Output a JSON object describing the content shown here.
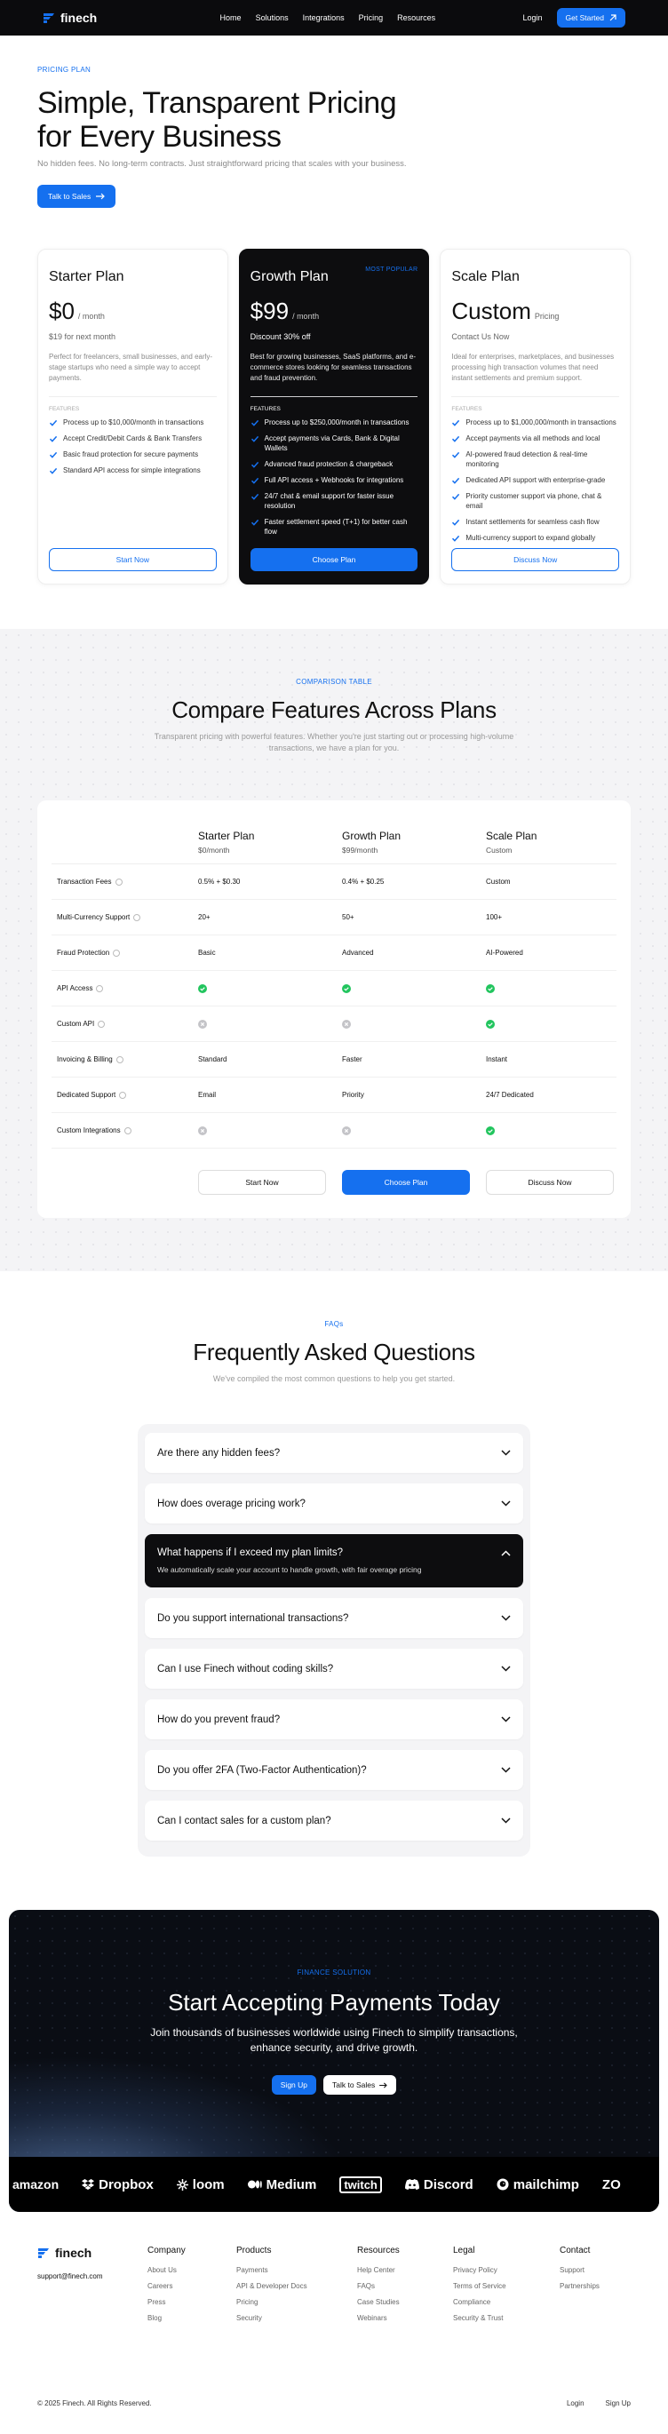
{
  "nav": {
    "brand": "finech",
    "links": [
      "Home",
      "Solutions",
      "Integrations",
      "Pricing",
      "Resources"
    ],
    "login": "Login",
    "cta": "Get Started"
  },
  "hero": {
    "eyebrow": "PRICING PLAN",
    "title": "Simple, Transparent Pricing for Every Business",
    "subtitle": "No hidden fees. No long-term contracts. Just straightforward pricing that scales with your business.",
    "cta": "Talk to Sales"
  },
  "plans": [
    {
      "name": "Starter Plan",
      "price": "$0",
      "period": "/ month",
      "sub": "$19 for next month",
      "desc": "Perfect for freelancers, small businesses, and early-stage startups who need a simple way to accept payments.",
      "features_label": "FEATURES",
      "features": [
        "Process up to $10,000/month in transactions",
        "Accept Credit/Debit Cards & Bank Transfers",
        "Basic fraud protection for secure payments",
        "Standard API access for simple integrations"
      ],
      "button": "Start Now"
    },
    {
      "name": "Growth Plan",
      "badge": "MOST POPULAR",
      "price": "$99",
      "period": "/ month",
      "sub": "Discount 30% off",
      "desc": "Best for growing businesses, SaaS platforms, and e-commerce stores looking for seamless transactions and fraud prevention.",
      "features_label": "FEATURES",
      "features": [
        "Process up to $250,000/month in transactions",
        "Accept payments via Cards, Bank & Digital Wallets",
        "Advanced fraud protection & chargeback",
        "Full API access + Webhooks for integrations",
        "24/7 chat & email support for faster issue resolution",
        "Faster settlement speed (T+1) for better cash flow"
      ],
      "button": "Choose Plan"
    },
    {
      "name": "Scale Plan",
      "price": "Custom",
      "period": "Pricing",
      "sub": "Contact Us Now",
      "desc": "Ideal for enterprises, marketplaces, and businesses processing high transaction volumes that need instant settlements and premium support.",
      "features_label": "FEATURES",
      "features": [
        "Process up to $1,000,000/month in transactions",
        "Accept payments via all methods and local",
        "AI-powered fraud detection & real-time monitoring",
        "Dedicated API support with enterprise-grade",
        "Priority customer support via phone, chat & email",
        "Instant settlements for seamless cash flow",
        "Multi-currency support to expand globally"
      ],
      "button": "Discuss Now"
    }
  ],
  "compare": {
    "eyebrow": "COMPARISON TABLE",
    "title": "Compare Features Across Plans",
    "subtitle": "Transparent pricing with powerful features. Whether you're just starting out or processing high-volume transactions, we have a plan for you.",
    "columns": [
      {
        "name": "Starter Plan",
        "price": "$0/month"
      },
      {
        "name": "Growth Plan",
        "price": "$99/month"
      },
      {
        "name": "Scale Plan",
        "price": "Custom"
      }
    ],
    "rows": [
      {
        "label": "Transaction Fees",
        "values": [
          "0.5% + $0.30",
          "0.4% + $0.25",
          "Custom"
        ]
      },
      {
        "label": "Multi-Currency Support",
        "values": [
          "20+",
          "50+",
          "100+"
        ]
      },
      {
        "label": "Fraud Protection",
        "values": [
          "Basic",
          "Advanced",
          "AI-Powered"
        ]
      },
      {
        "label": "API Access",
        "values": [
          "check",
          "check",
          "check"
        ]
      },
      {
        "label": "Custom API",
        "values": [
          "x",
          "x",
          "check"
        ]
      },
      {
        "label": "Invoicing & Billing",
        "values": [
          "Standard",
          "Faster",
          "Instant"
        ]
      },
      {
        "label": "Dedicated Support",
        "values": [
          "Email",
          "Priority",
          "24/7 Dedicated"
        ]
      },
      {
        "label": "Custom Integrations",
        "values": [
          "x",
          "x",
          "check"
        ]
      }
    ],
    "buttons": [
      "Start Now",
      "Choose Plan",
      "Discuss Now"
    ]
  },
  "faq": {
    "eyebrow": "FAQs",
    "title": "Frequently Asked Questions",
    "subtitle": "We've compiled the most common questions to help you get started.",
    "items": [
      {
        "q": "Are there any hidden fees?"
      },
      {
        "q": "How does overage pricing work?"
      },
      {
        "q": "What happens if I exceed my plan limits?",
        "a": "We automatically scale your account to handle growth, with fair overage pricing",
        "open": true
      },
      {
        "q": "Do you support international transactions?"
      },
      {
        "q": "Can I use Finech without coding skills?"
      },
      {
        "q": "How do you prevent fraud?"
      },
      {
        "q": "Do you offer 2FA (Two-Factor Authentication)?"
      },
      {
        "q": "Can I contact sales for a custom plan?"
      }
    ]
  },
  "cta": {
    "eyebrow": "FINANCE SOLUTION",
    "title": "Start Accepting Payments Today",
    "subtitle": "Join thousands of businesses worldwide using Finech to simplify transactions, enhance security, and drive growth.",
    "signup": "Sign Up",
    "sales": "Talk to Sales",
    "logos": [
      "amazon",
      "Dropbox",
      "loom",
      "Medium",
      "twitch",
      "Discord",
      "mailchimp",
      "ZO"
    ]
  },
  "footer": {
    "brand": "finech",
    "email": "support@finech.com",
    "columns": [
      {
        "title": "Company",
        "links": [
          "About Us",
          "Careers",
          "Press",
          "Blog"
        ]
      },
      {
        "title": "Products",
        "links": [
          "Payments",
          "API & Developer Docs",
          "Pricing",
          "Security"
        ]
      },
      {
        "title": "Resources",
        "links": [
          "Help Center",
          "FAQs",
          "Case Studies",
          "Webinars"
        ]
      },
      {
        "title": "Legal",
        "links": [
          "Privacy Policy",
          "Terms of Service",
          "Compliance",
          "Security & Trust"
        ]
      },
      {
        "title": "Contact",
        "links": [
          "Support",
          "Partnerships"
        ]
      }
    ],
    "copyright": "© 2025 Finech. All Rights Reserved.",
    "login": "Login",
    "signup": "Sign Up"
  },
  "colors": {
    "accent": "#1570ef",
    "dark": "#0d0d0f",
    "check": "#22c55e"
  }
}
